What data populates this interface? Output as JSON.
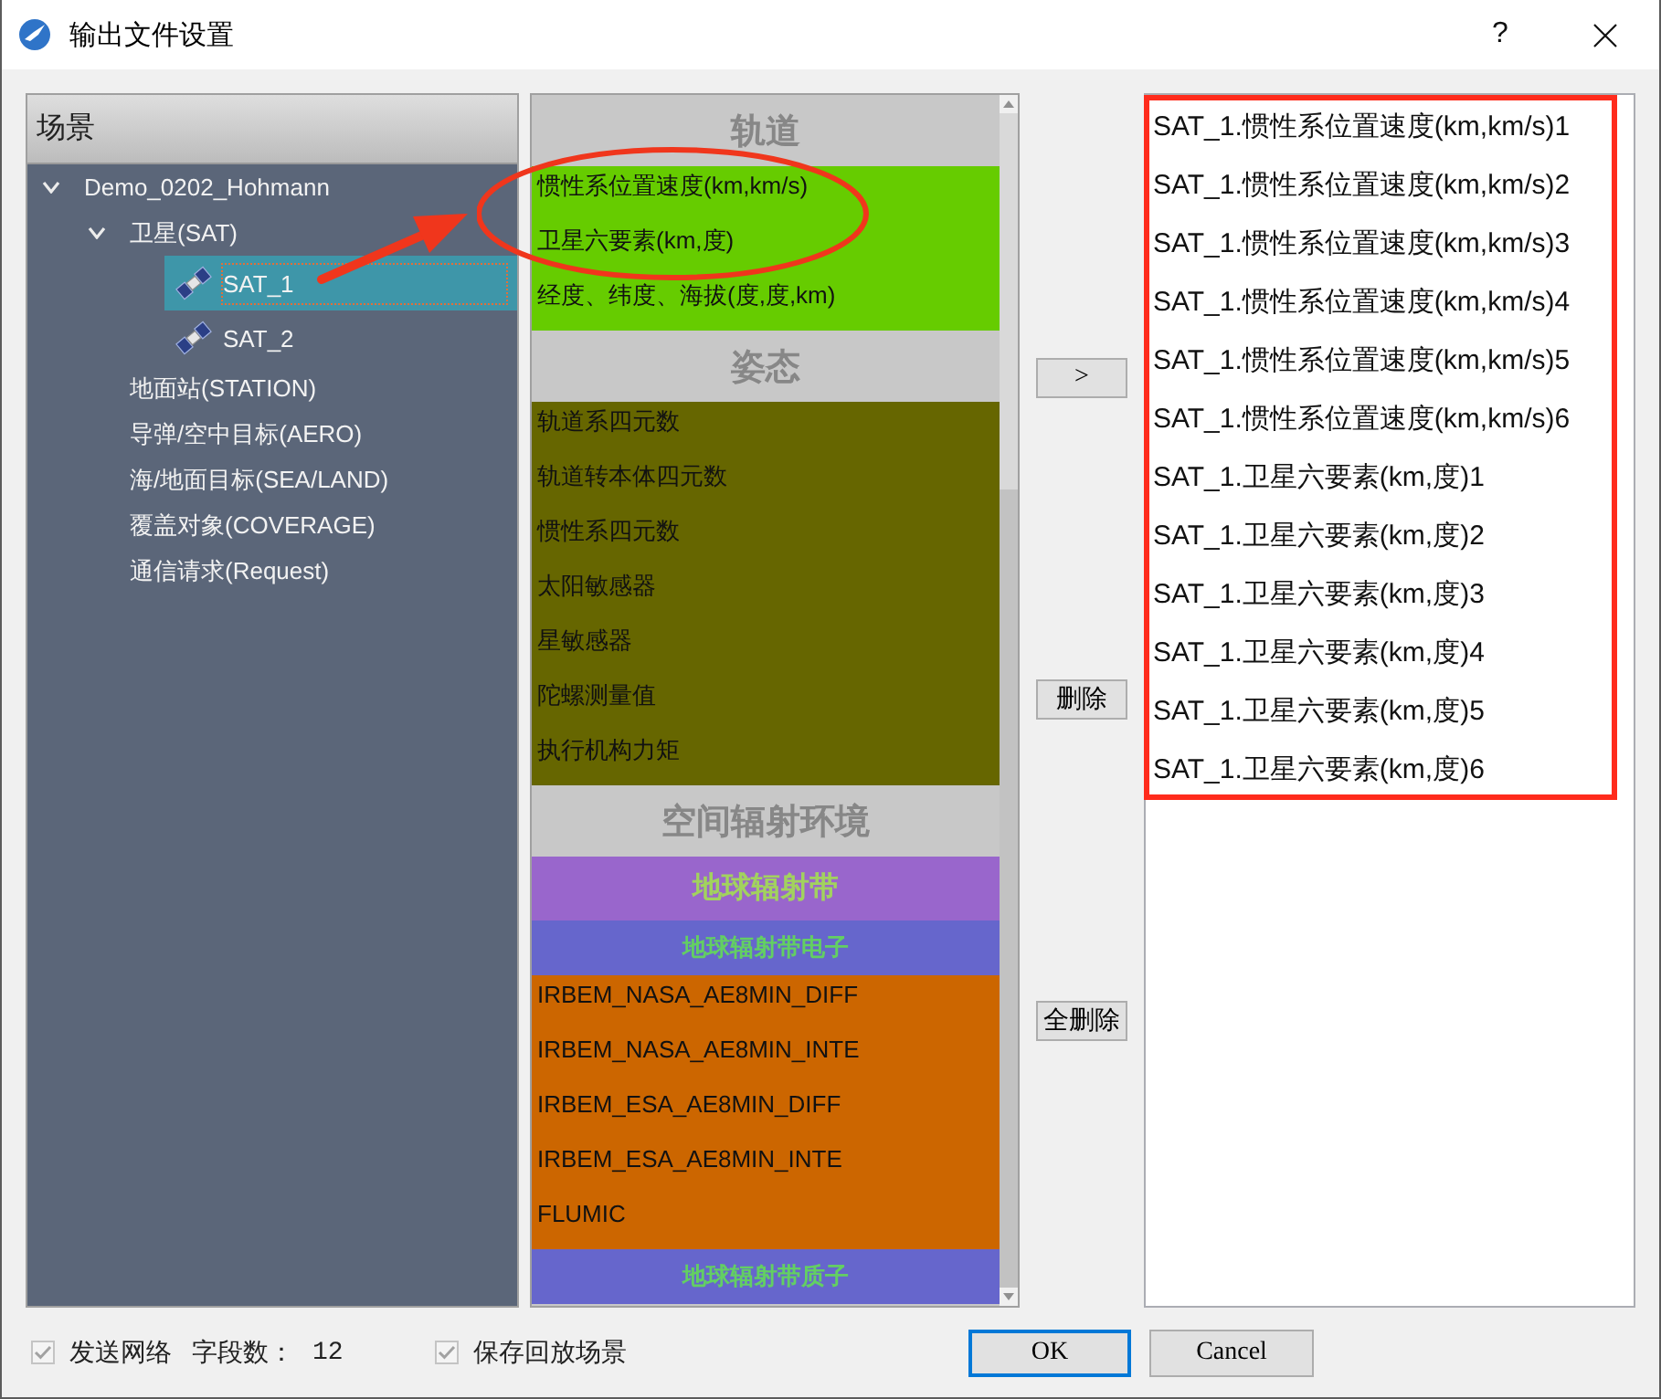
{
  "window": {
    "title": "输出文件设置",
    "help": "?"
  },
  "scene_tree": {
    "header": "场景",
    "items": [
      {
        "label": "Demo_0202_Hohmann",
        "kind": "node",
        "expanded": true,
        "selected": false,
        "children": [
          {
            "label": "卫星(SAT)",
            "kind": "node",
            "expanded": true,
            "selected": false,
            "children": [
              {
                "label": "SAT_1",
                "kind": "satellite",
                "selected": true
              },
              {
                "label": "SAT_2",
                "kind": "satellite",
                "selected": false
              }
            ]
          },
          {
            "label": "地面站(STATION)",
            "kind": "node",
            "selected": false
          },
          {
            "label": "导弹/空中目标(AERO)",
            "kind": "node",
            "selected": false
          },
          {
            "label": "海/地面目标(SEA/LAND)",
            "kind": "node",
            "selected": false
          },
          {
            "label": "覆盖对象(COVERAGE)",
            "kind": "node",
            "selected": false
          },
          {
            "label": "通信请求(Request)",
            "kind": "node",
            "selected": false
          }
        ]
      }
    ]
  },
  "categories": [
    {
      "kind": "section",
      "text": "轨道",
      "children": [
        {
          "kind": "item",
          "text": "惯性系位置速度(km,km/s)",
          "color": "#66cc00"
        },
        {
          "kind": "item",
          "text": "卫星六要素(km,度)",
          "color": "#66cc00"
        },
        {
          "kind": "item",
          "text": "经度、纬度、海拔(度,度,km)",
          "color": "#66cc00"
        }
      ]
    },
    {
      "kind": "section",
      "text": "姿态",
      "children": [
        {
          "kind": "item",
          "text": "轨道系四元数",
          "color": "#666600"
        },
        {
          "kind": "item",
          "text": "轨道转本体四元数",
          "color": "#666600"
        },
        {
          "kind": "item",
          "text": "惯性系四元数",
          "color": "#666600"
        },
        {
          "kind": "item",
          "text": "太阳敏感器",
          "color": "#666600"
        },
        {
          "kind": "item",
          "text": "星敏感器",
          "color": "#666600"
        },
        {
          "kind": "item",
          "text": "陀螺测量值",
          "color": "#666600"
        },
        {
          "kind": "item",
          "text": "执行机构力矩",
          "color": "#666600"
        }
      ]
    },
    {
      "kind": "section",
      "text": "空间辐射环境",
      "children": [
        {
          "kind": "group",
          "text": "地球辐射带",
          "color": "#9966cc",
          "children": [
            {
              "kind": "subgroup",
              "text": "地球辐射带电子",
              "color": "#6666cc",
              "children": [
                {
                  "kind": "item",
                  "text": "IRBEM_NASA_AE8MIN_DIFF",
                  "color": "#cc6600"
                },
                {
                  "kind": "item",
                  "text": "IRBEM_NASA_AE8MIN_INTE",
                  "color": "#cc6600"
                },
                {
                  "kind": "item",
                  "text": "IRBEM_ESA_AE8MIN_DIFF",
                  "color": "#cc6600"
                },
                {
                  "kind": "item",
                  "text": "IRBEM_ESA_AE8MIN_INTE",
                  "color": "#cc6600"
                },
                {
                  "kind": "item",
                  "text": "FLUMIC",
                  "color": "#cc6600"
                }
              ]
            },
            {
              "kind": "subgroup",
              "text": "地球辐射带质子",
              "color": "#6666cc"
            }
          ]
        }
      ]
    }
  ],
  "transfer_buttons": [
    ">",
    "删除",
    "全删除"
  ],
  "output_fields": [
    "SAT_1.惯性系位置速度(km,km/s)1",
    "SAT_1.惯性系位置速度(km,km/s)2",
    "SAT_1.惯性系位置速度(km,km/s)3",
    "SAT_1.惯性系位置速度(km,km/s)4",
    "SAT_1.惯性系位置速度(km,km/s)5",
    "SAT_1.惯性系位置速度(km,km/s)6",
    "SAT_1.卫星六要素(km,度)1",
    "SAT_1.卫星六要素(km,度)2",
    "SAT_1.卫星六要素(km,度)3",
    "SAT_1.卫星六要素(km,度)4",
    "SAT_1.卫星六要素(km,度)5",
    "SAT_1.卫星六要素(km,度)6"
  ],
  "annotations": [
    {
      "kind": "arrow"
    },
    {
      "kind": "ellipse"
    },
    {
      "kind": "frame"
    }
  ],
  "footer": {
    "send_network": {
      "label": "发送网络",
      "checked": true,
      "disabled": true
    },
    "field_count": {
      "label": "字段数：",
      "value": "12"
    },
    "save_replay": {
      "label": "保存回放场景",
      "checked": true,
      "disabled": true
    },
    "buttons": [
      {
        "label": "OK",
        "default": true
      },
      {
        "label": "Cancel",
        "default": false
      }
    ]
  }
}
